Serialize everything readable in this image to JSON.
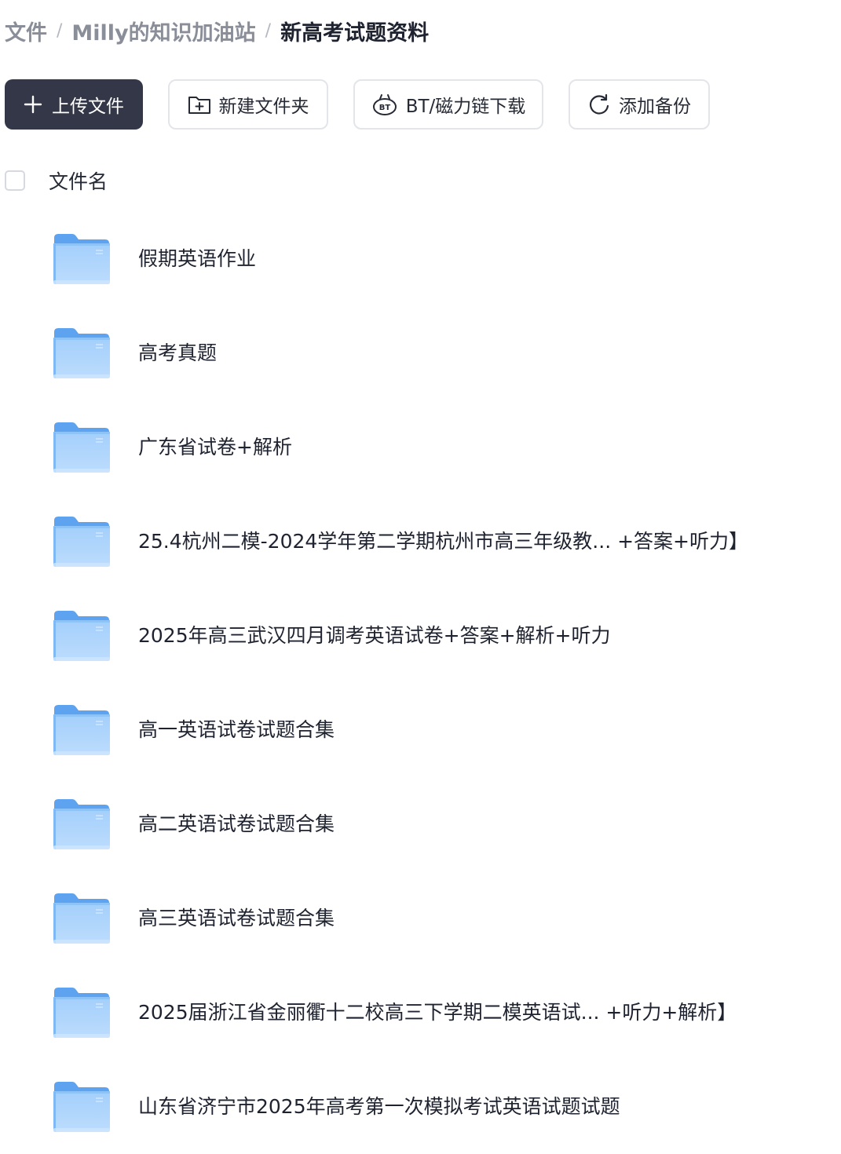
{
  "breadcrumb": {
    "items": [
      "文件",
      "Milly的知识加油站",
      "新高考试题资料"
    ],
    "separator": "/"
  },
  "toolbar": {
    "upload_label": "上传文件",
    "new_folder_label": "新建文件夹",
    "bt_label": "BT/磁力链下载",
    "backup_label": "添加备份"
  },
  "list": {
    "header_label": "文件名",
    "files": [
      {
        "name": "假期英语作业",
        "icon": "folder-icon"
      },
      {
        "name": "高考真题",
        "icon": "folder-icon"
      },
      {
        "name": "广东省试卷+解析",
        "icon": "folder-icon"
      },
      {
        "name": "25.4杭州二模-2024学年第二学期杭州市高三年级教...  +答案+听力】",
        "icon": "folder-icon"
      },
      {
        "name": "2025年高三武汉四月调考英语试卷+答案+解析+听力",
        "icon": "folder-icon"
      },
      {
        "name": "高一英语试卷试题合集",
        "icon": "folder-icon"
      },
      {
        "name": "高二英语试卷试题合集",
        "icon": "folder-icon"
      },
      {
        "name": "高三英语试卷试题合集",
        "icon": "folder-icon"
      },
      {
        "name": "2025届浙江省金丽衢十二校高三下学期二模英语试...   +听力+解析】",
        "icon": "folder-icon"
      },
      {
        "name": "山东省济宁市2025年高考第一次模拟考试英语试题试题",
        "icon": "folder-icon"
      }
    ]
  },
  "colors": {
    "primary_button": "#333747",
    "folder_light": "#a9d2fb",
    "folder_dark": "#5ea3ef",
    "muted_text": "#8a8e99"
  }
}
